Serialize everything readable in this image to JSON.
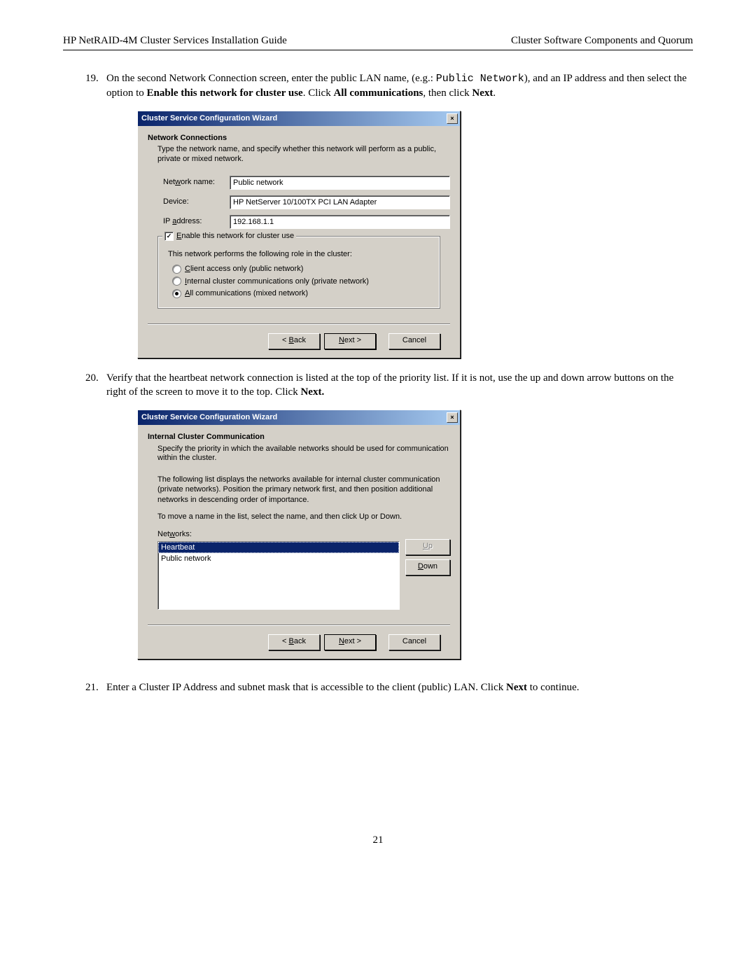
{
  "header": {
    "left": "HP NetRAID-4M Cluster Services Installation Guide",
    "right": "Cluster Software Components and Quorum"
  },
  "steps": {
    "s19": {
      "num": "19.",
      "pre1": "On the second Network Connection screen, enter the public LAN name, (e.g.: ",
      "code1": "Public Network",
      "mid1": "), and an IP address and then select the option to ",
      "bold1": "Enable this network for cluster use",
      "mid2": ".  Click ",
      "bold2": "All communications",
      "mid3": ", then click ",
      "bold3": "Next",
      "end": "."
    },
    "s20": {
      "num": "20.",
      "text1": "Verify that the heartbeat network connection is listed at the top of the priority list.  If it is not, use the up and down arrow buttons on the right of the screen to move it to the top. Click ",
      "bold1": "Next.",
      "end": ""
    },
    "s21": {
      "num": "21.",
      "text1": "Enter a Cluster IP Address and subnet mask that is accessible to the client (public) LAN. Click ",
      "bold1": "Next",
      "end": " to continue."
    }
  },
  "dialog1": {
    "title": "Cluster Service Configuration Wizard",
    "heading": "Network Connections",
    "subtext": "Type the network name, and specify whether this network will perform as a public, private or mixed network.",
    "labels": {
      "network_name": "Network name:",
      "device": "Device:",
      "ip": "IP address:"
    },
    "values": {
      "network_name": "Public network",
      "device": "HP NetServer 10/100TX PCI LAN Adapter",
      "ip": "192.168.1.1"
    },
    "checkbox_label": "Enable this network for cluster use",
    "checkbox_checked": "✓",
    "role_label": "This network performs the following role in the cluster:",
    "radios": {
      "r1": "Client access only (public network)",
      "r2": "Internal cluster communications only (private network)",
      "r3": "All communications (mixed network)"
    },
    "buttons": {
      "back": "< Back",
      "next": "Next >",
      "cancel": "Cancel"
    },
    "u": {
      "w": "w",
      "E": "E",
      "C": "C",
      "I": "I",
      "A": "A",
      "B": "B",
      "N": "N",
      "a": "a"
    }
  },
  "dialog2": {
    "title": "Cluster Service Configuration Wizard",
    "heading": "Internal Cluster Communication",
    "subtext": "Specify the priority in which the available networks should be used for communication within the cluster.",
    "intro": "The following list displays the networks available for internal cluster communication (private networks). Position the primary network first, and then position additional networks in descending order of importance.",
    "movehint": "To move a name in the list, select the name, and then click Up or Down.",
    "list_label": "Networks:",
    "items": {
      "i1": "Heartbeat",
      "i2": "Public network"
    },
    "buttons": {
      "up": "Up",
      "down": "Down",
      "back": "< Back",
      "next": "Next >",
      "cancel": "Cancel"
    },
    "u": {
      "w": "w",
      "U": "U",
      "D": "D",
      "B": "B",
      "N": "N"
    }
  },
  "page_number": "21"
}
